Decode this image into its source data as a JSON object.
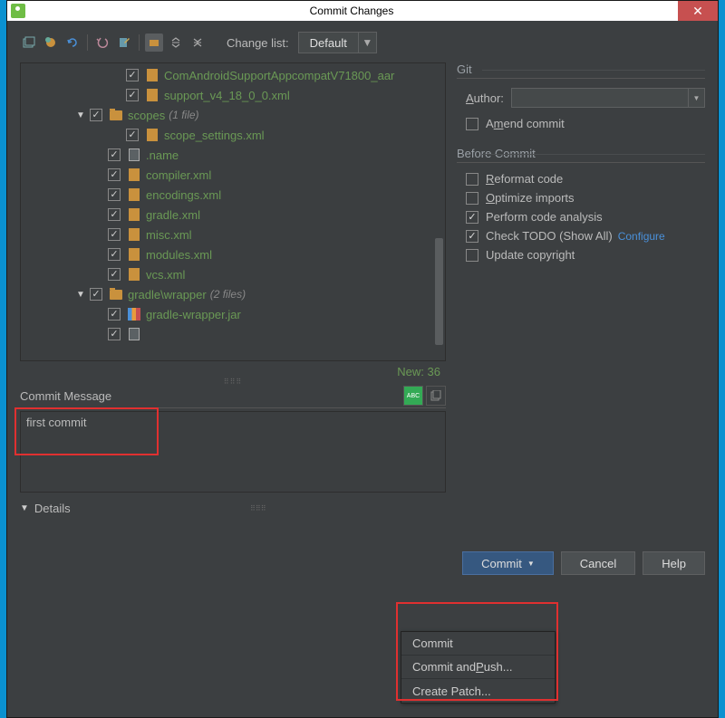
{
  "window": {
    "title": "Commit Changes"
  },
  "toolbar": {
    "change_list_label": "Change list:",
    "change_list_value": "Default"
  },
  "tree": {
    "items": [
      {
        "indent": 5,
        "checked": true,
        "icon": "xml",
        "label": "ComAndroidSupportAppcompatV71800_aar"
      },
      {
        "indent": 5,
        "checked": true,
        "icon": "xml",
        "label": "support_v4_18_0_0.xml"
      },
      {
        "indent": 3,
        "checked": true,
        "icon": "folder",
        "label": "scopes",
        "count": "(1 file)",
        "arrow": true
      },
      {
        "indent": 5,
        "checked": true,
        "icon": "xml",
        "label": "scope_settings.xml"
      },
      {
        "indent": 4,
        "checked": true,
        "icon": "plain",
        "label": ".name"
      },
      {
        "indent": 4,
        "checked": true,
        "icon": "xml",
        "label": "compiler.xml"
      },
      {
        "indent": 4,
        "checked": true,
        "icon": "xml",
        "label": "encodings.xml"
      },
      {
        "indent": 4,
        "checked": true,
        "icon": "xml",
        "label": "gradle.xml"
      },
      {
        "indent": 4,
        "checked": true,
        "icon": "xml",
        "label": "misc.xml"
      },
      {
        "indent": 4,
        "checked": true,
        "icon": "xml",
        "label": "modules.xml"
      },
      {
        "indent": 4,
        "checked": true,
        "icon": "xml",
        "label": "vcs.xml"
      },
      {
        "indent": 3,
        "checked": true,
        "icon": "folder",
        "label": "gradle\\wrapper",
        "count": "(2 files)",
        "arrow": true
      },
      {
        "indent": 4,
        "checked": true,
        "icon": "jar",
        "label": "gradle-wrapper.jar"
      },
      {
        "indent": 4,
        "checked": true,
        "icon": "plain",
        "label": ""
      }
    ]
  },
  "status": {
    "new_label": "New: 36"
  },
  "git": {
    "section_title": "Git",
    "author_label": "Author:",
    "author_value": "",
    "amend_label": "Amend commit",
    "amend_checked": false
  },
  "before_commit": {
    "section_title": "Before Commit",
    "options": [
      {
        "label": "Reformat code",
        "underline": "R",
        "checked": false
      },
      {
        "label": "Optimize imports",
        "underline": "O",
        "checked": false
      },
      {
        "label": "Perform code analysis",
        "underline": "",
        "checked": true
      },
      {
        "label": "Check TODO (Show All)",
        "underline": "",
        "checked": true,
        "link": "Configure"
      },
      {
        "label": "Update copyright",
        "underline": "",
        "checked": false
      }
    ]
  },
  "commit_message": {
    "title": "Commit Message",
    "value": "first commit"
  },
  "details": {
    "label": "Details"
  },
  "buttons": {
    "commit": "Commit",
    "cancel": "Cancel",
    "help": "Help"
  },
  "popup": {
    "items": [
      "Commit",
      "Commit and Push...",
      "Create Patch..."
    ]
  }
}
